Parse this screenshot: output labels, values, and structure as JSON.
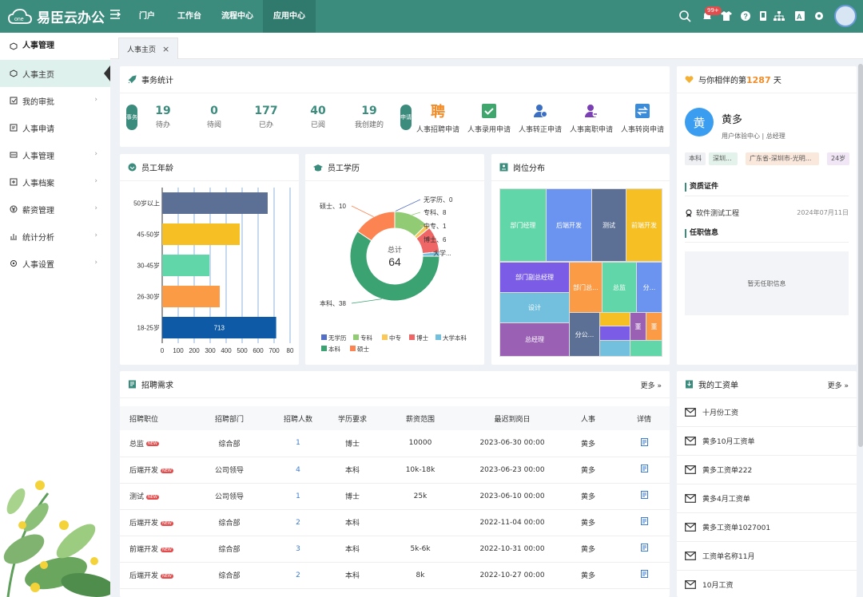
{
  "app": {
    "name": "易臣云办公"
  },
  "nav": {
    "tabs": [
      "门户",
      "工作台",
      "流程中心",
      "应用中心"
    ],
    "active": 3
  },
  "topbar": {
    "notif_badge": "99+"
  },
  "sidebar": {
    "header": "人事管理",
    "items": [
      {
        "label": "人事主页"
      },
      {
        "label": "我的审批"
      },
      {
        "label": "人事申请"
      },
      {
        "label": "人事管理"
      },
      {
        "label": "人事档案"
      },
      {
        "label": "薪资管理"
      },
      {
        "label": "统计分析"
      },
      {
        "label": "人事设置"
      }
    ]
  },
  "page_tab": {
    "label": "人事主页"
  },
  "stats": {
    "title": "事务统计",
    "badge_todo": "事务",
    "items": [
      {
        "value": "19",
        "label": "待办"
      },
      {
        "value": "0",
        "label": "待阅"
      },
      {
        "value": "177",
        "label": "已办"
      },
      {
        "value": "40",
        "label": "已阅"
      },
      {
        "value": "19",
        "label": "我创建的"
      }
    ],
    "badge_apply": "申请",
    "apps": [
      {
        "label": "人事招聘申请",
        "icon": "recruit-icon",
        "glyph": "聘"
      },
      {
        "label": "人事录用申请",
        "icon": "check-icon"
      },
      {
        "label": "人事转正申请",
        "icon": "user-confirm-icon"
      },
      {
        "label": "人事离职申请",
        "icon": "user-leave-icon"
      },
      {
        "label": "人事转岗申请",
        "icon": "transfer-icon"
      }
    ]
  },
  "age_chart": {
    "title": "员工年龄"
  },
  "edu_chart": {
    "title": "员工学历"
  },
  "pos_chart": {
    "title": "岗位分布"
  },
  "chart_data": [
    {
      "type": "bar",
      "orientation": "horizontal",
      "categories": [
        "18-25岁",
        "26-30岁",
        "30-45岁",
        "45-50岁",
        "50岁以上"
      ],
      "values": [
        713,
        360,
        295,
        485,
        660
      ],
      "data_labels": [
        {
          "index": 0,
          "text": "713"
        }
      ],
      "colors": [
        "#0e5aa7",
        "#fb9b45",
        "#61d6a8",
        "#f6c024",
        "#5c7096"
      ],
      "xticks": [
        0,
        100,
        200,
        300,
        400,
        500,
        600,
        700,
        800
      ],
      "xtick_labels": [
        "0",
        "100",
        "200",
        "300",
        "400",
        "500",
        "600",
        "700",
        "80"
      ],
      "xlim": [
        0,
        800
      ],
      "grid": true
    },
    {
      "type": "pie",
      "donut": true,
      "center_label": "总计",
      "center_value": "64",
      "slices": [
        {
          "name": "无学历",
          "value": 0,
          "color": "#5470c6",
          "label": "无学历、0"
        },
        {
          "name": "专科",
          "value": 8,
          "color": "#91cc75",
          "label": "专科、8"
        },
        {
          "name": "中专",
          "value": 1,
          "color": "#fac858",
          "label": "中专、1"
        },
        {
          "name": "博士",
          "value": 6,
          "color": "#ee6666",
          "label": "博士、6"
        },
        {
          "name": "大学本科",
          "value": 1,
          "color": "#73c0de",
          "label": "大学..."
        },
        {
          "name": "本科",
          "value": 38,
          "color": "#3ba272",
          "label": "本科、38"
        },
        {
          "name": "硕士",
          "value": 10,
          "color": "#fc8452",
          "label": "硕士、10"
        }
      ],
      "legend": [
        "无学历",
        "专科",
        "中专",
        "博士",
        "大学本科",
        "本科",
        "硕士"
      ],
      "legend_position": "bottom"
    },
    {
      "type": "treemap",
      "cells": [
        {
          "label": "部门经理",
          "color": "#61d6a8"
        },
        {
          "label": "后端开发",
          "color": "#6b93f0"
        },
        {
          "label": "测试",
          "color": "#5c7096"
        },
        {
          "label": "前端开发",
          "color": "#f6c024"
        },
        {
          "label": "部门副总经理",
          "color": "#7b5ce6"
        },
        {
          "label": "部门总...",
          "color": "#fb9b45"
        },
        {
          "label": "总监",
          "color": "#61d6a8"
        },
        {
          "label": "分...",
          "color": "#6b93f0"
        },
        {
          "label": "设计",
          "color": "#73c0de"
        },
        {
          "label": "总经理",
          "color": "#9a60b4"
        },
        {
          "label": "分公...",
          "color": "#5c7096"
        },
        {
          "label": "",
          "color": "#f6c024"
        },
        {
          "label": "",
          "color": "#7b5ce6"
        },
        {
          "label": "董",
          "color": "#9a60b4"
        },
        {
          "label": "董",
          "color": "#fb9b45"
        },
        {
          "label": "",
          "color": "#73c0de"
        },
        {
          "label": "",
          "color": "#61d6a8"
        }
      ]
    }
  ],
  "recruit": {
    "title": "招聘需求",
    "more": "更多",
    "new_tag": "NEW",
    "columns": [
      "招聘职位",
      "招聘部门",
      "招聘人数",
      "学历要求",
      "薪资范围",
      "最迟到岗日",
      "人事",
      "详情"
    ],
    "rows": [
      {
        "position": "总监",
        "dept": "综合部",
        "count": "1",
        "edu": "博士",
        "salary": "10000",
        "date": "2023-06-30 00:00",
        "hr": "黄多"
      },
      {
        "position": "后端开发",
        "dept": "公司领导",
        "count": "4",
        "edu": "本科",
        "salary": "10k-18k",
        "date": "2023-06-23 00:00",
        "hr": "黄多"
      },
      {
        "position": "测试",
        "dept": "公司领导",
        "count": "1",
        "edu": "博士",
        "salary": "25k",
        "date": "2023-06-10 00:00",
        "hr": "黄多"
      },
      {
        "position": "后端开发",
        "dept": "综合部",
        "count": "2",
        "edu": "本科",
        "salary": "",
        "date": "2022-11-04 00:00",
        "hr": "黄多"
      },
      {
        "position": "前端开发",
        "dept": "综合部",
        "count": "3",
        "edu": "本科",
        "salary": "5k-6k",
        "date": "2022-10-31 00:00",
        "hr": "黄多"
      },
      {
        "position": "后端开发",
        "dept": "综合部",
        "count": "2",
        "edu": "本科",
        "salary": "8k",
        "date": "2022-10-27 00:00",
        "hr": "黄多"
      }
    ]
  },
  "profile": {
    "companion_prefix": "与你相伴的第",
    "companion_days": "1287",
    "companion_suffix": "天",
    "avatar_char": "黄",
    "name": "黄多",
    "subtitle": "用户体验中心 | 总经理",
    "tags": [
      "本科",
      "深圳...",
      "广东省-深圳市-光明...",
      "24岁"
    ],
    "cert_title": "资质证件",
    "cert_name": "软件测试工程",
    "cert_date": "2024年07月11日",
    "job_title": "任职信息",
    "job_empty": "暂无任职信息"
  },
  "salary": {
    "title": "我的工资单",
    "more": "更多",
    "items": [
      "十月份工资",
      "黄多10月工资单",
      "黄多工资单222",
      "黄多4月工资单",
      "黄多工资单1027001",
      "工资单名称11月",
      "10月工资"
    ]
  },
  "colors": {
    "primary": "#3c8c7e",
    "accent": "#f28c28",
    "link": "#3b7bd3"
  }
}
